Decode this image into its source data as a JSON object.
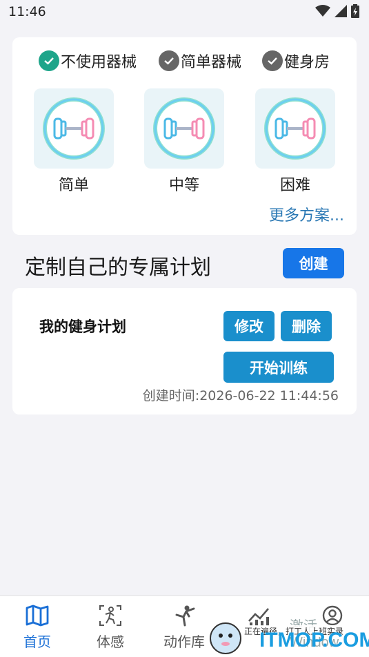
{
  "status": {
    "time": "11:46"
  },
  "equipment": [
    {
      "label": "不使用器械",
      "checked": true
    },
    {
      "label": "简单器械",
      "checked": false
    },
    {
      "label": "健身房",
      "checked": false
    }
  ],
  "levels": [
    {
      "label": "简单"
    },
    {
      "label": "中等"
    },
    {
      "label": "困难"
    }
  ],
  "more_link": "更多方案...",
  "custom": {
    "title": "定制自己的专属计划",
    "create_label": "创建"
  },
  "plan": {
    "name": "我的健身计划",
    "edit_label": "修改",
    "delete_label": "删除",
    "start_label": "开始训练",
    "created": "创建时间:2026-06-22 11:44:56"
  },
  "tabs": [
    {
      "label": "首页",
      "icon": "map-icon",
      "active": true
    },
    {
      "label": "体感",
      "icon": "motion-icon",
      "active": false
    },
    {
      "label": "动作库",
      "icon": "martial-arts-icon",
      "active": false
    },
    {
      "label": "",
      "icon": "chart-icon",
      "active": false
    },
    {
      "label": "",
      "icon": "profile-icon",
      "active": false
    }
  ],
  "watermark": {
    "activate": "激活 Window",
    "brand": "ITMOP.COM",
    "note": "正在遍径，打工人上班实录"
  },
  "colors": {
    "accent": "#1776e8",
    "button": "#1a8fcc",
    "check_on": "#1ea58a",
    "link": "#2a78b4",
    "tab_active": "#1a6fd6"
  }
}
